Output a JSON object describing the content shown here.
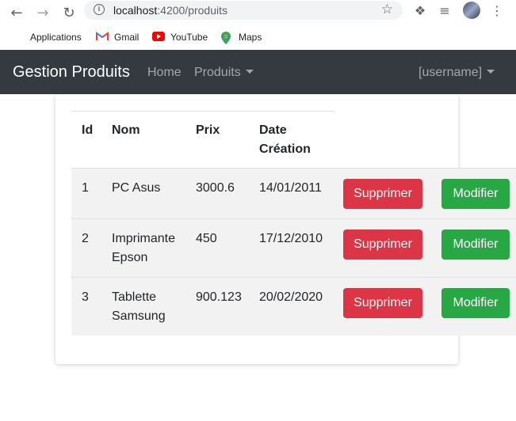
{
  "browser": {
    "url_host": "localhost",
    "url_rest": ":4200/produits",
    "icons": [
      "back-arrow-icon",
      "forward-arrow-icon",
      "reload-icon",
      "info-icon",
      "star-icon",
      "extensions-icon",
      "media-icon",
      "profile-avatar",
      "more-menu-icon"
    ]
  },
  "bookmarks": {
    "items": [
      {
        "label": "Applications",
        "icon": "apps-grid-icon"
      },
      {
        "label": "Gmail",
        "icon": "gmail-icon"
      },
      {
        "label": "YouTube",
        "icon": "youtube-icon"
      },
      {
        "label": "Maps",
        "icon": "maps-icon"
      }
    ]
  },
  "navbar": {
    "brand": "Gestion Produits",
    "home": "Home",
    "produits": "Produits",
    "user": "[username]",
    "bg_color": "#343a40"
  },
  "table": {
    "headers": {
      "id": "Id",
      "nom": "Nom",
      "prix": "Prix",
      "date_line1": "Date",
      "date_line2": "Création"
    },
    "rows": [
      {
        "id": "1",
        "nom_line1": "PC Asus",
        "nom_line2": "",
        "prix": "3000.6",
        "date": "14/01/2011"
      },
      {
        "id": "2",
        "nom_line1": "Imprimante",
        "nom_line2": "Epson",
        "prix": "450",
        "date": "17/12/2010"
      },
      {
        "id": "3",
        "nom_line1": "Tablette",
        "nom_line2": "Samsung",
        "prix": "900.123",
        "date": "20/02/2020"
      }
    ],
    "delete_label": "Supprimer",
    "edit_label": "Modifier",
    "delete_color": "#dc3545",
    "edit_color": "#28a745"
  }
}
